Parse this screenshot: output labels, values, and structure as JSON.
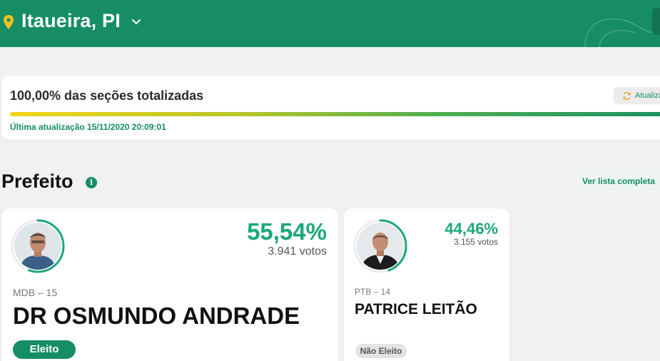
{
  "header": {
    "location": "Itaueira, PI",
    "pin_icon": "location-pin-icon",
    "accent": "#168d63"
  },
  "status": {
    "title": "100,00% das seções totalizadas",
    "progress": 1.0,
    "last_update": "Última atualização 15/11/2020 20:09:01",
    "refresh_label": "Atualiza"
  },
  "section": {
    "title": "Prefeito",
    "list_button": "Ver lista completa"
  },
  "candidates": [
    {
      "party": "MDB – 15",
      "name": "DR OSMUNDO ANDRADE",
      "percent": "55,54%",
      "votes": "3.941 votos",
      "vote_share": 0.5554,
      "status": "Eleito"
    },
    {
      "party": "PTB – 14",
      "name": "PATRICE LEITÃO",
      "percent": "44,46%",
      "votes": "3.155 votos",
      "vote_share": 0.4446,
      "status": "Não Eleito"
    }
  ]
}
